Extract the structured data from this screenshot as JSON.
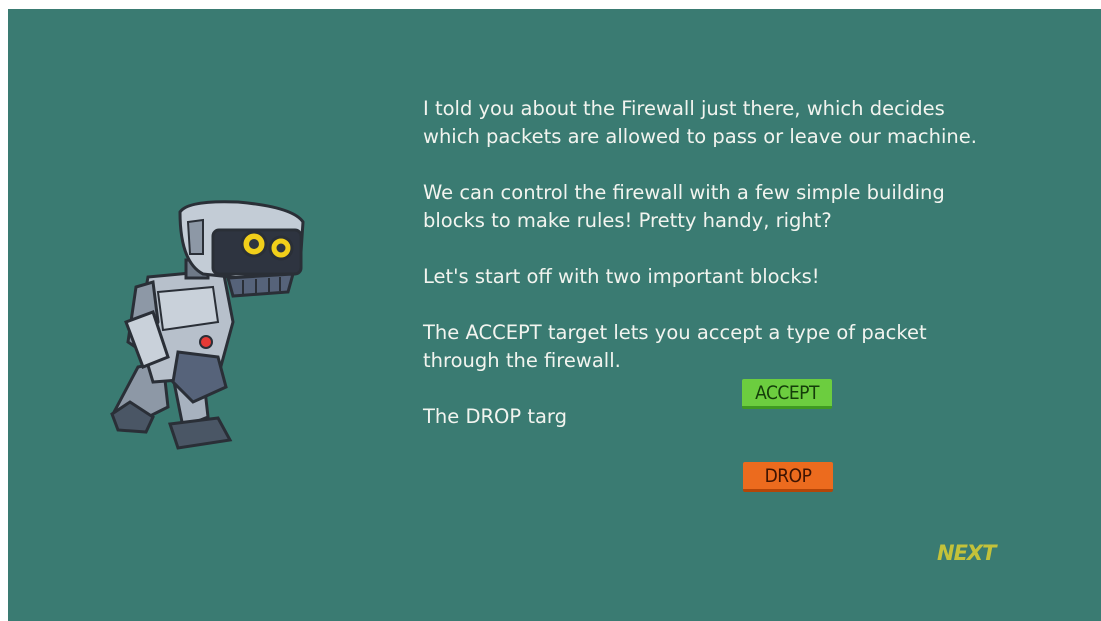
{
  "dialog": {
    "paragraphs": [
      "I told you about the Firewall just there, which decides which packets are allowed to pass or leave our machine.",
      "We can control the firewall with a few simple building blocks to make rules! Pretty handy, right?",
      "Let's start off with two important blocks!",
      "The ACCEPT target lets you accept a type of packet through the firewall.",
      "The DROP targ"
    ]
  },
  "blocks": {
    "accept_label": "ACCEPT",
    "drop_label": "DROP",
    "accept_color": "#6ccd3f",
    "drop_color": "#ec6b1e"
  },
  "navigation": {
    "next_label": "NEXT"
  },
  "character": {
    "icon": "robot-icon"
  },
  "colors": {
    "background": "#3a7b72",
    "text": "#f2f4ef",
    "next": "#c4c23a"
  }
}
